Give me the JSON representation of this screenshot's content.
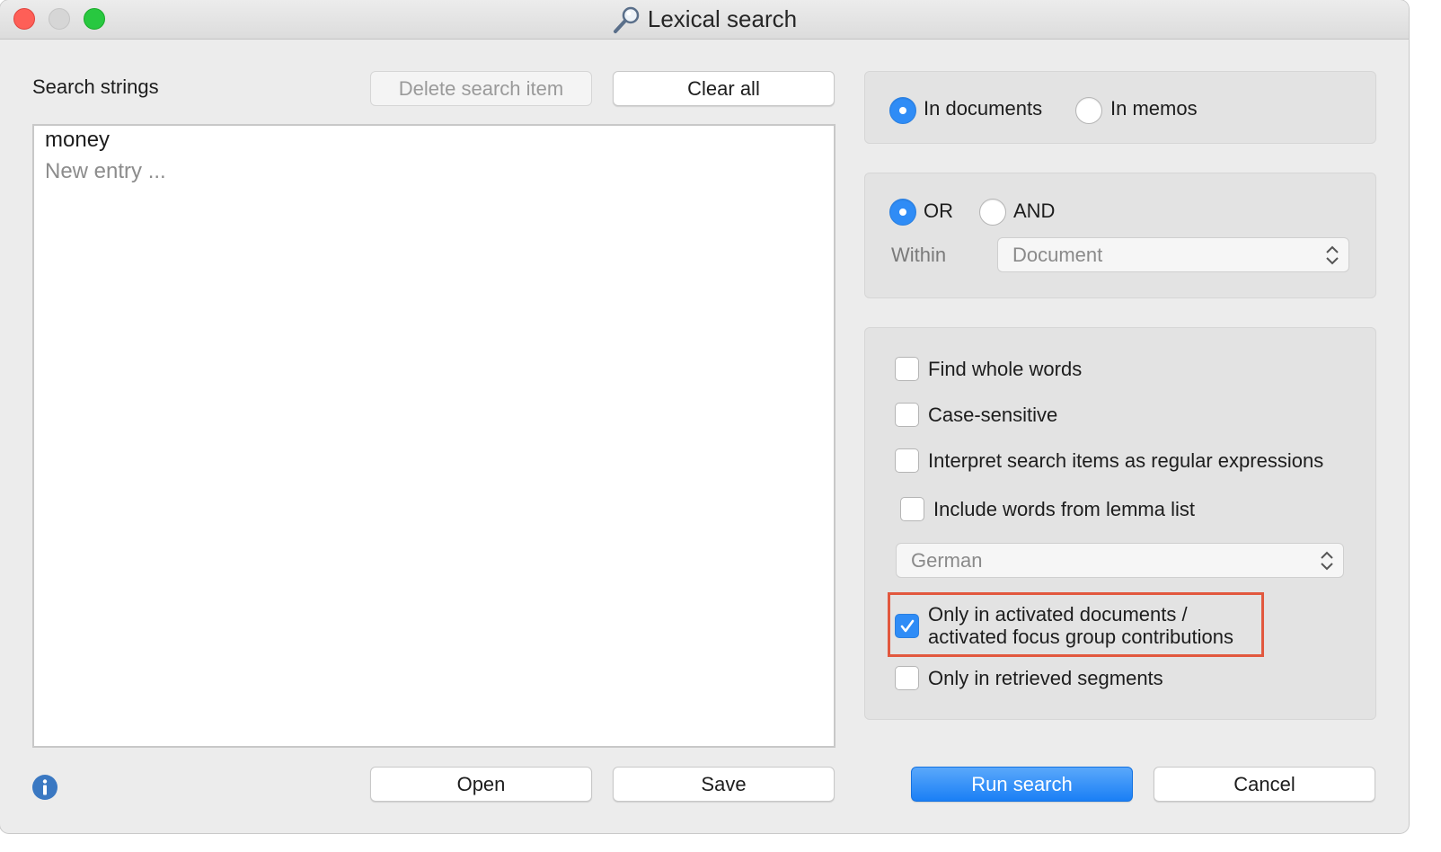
{
  "window": {
    "title": "Lexical search"
  },
  "icons": {
    "title": "magnifier-icon",
    "info": "info-icon",
    "check": "checkmark-icon",
    "select": "updown-chevron-icon"
  },
  "colors": {
    "accent": "#2f8cf6",
    "highlight": "#e2583e",
    "primary_button": "#1a7ff5"
  },
  "search": {
    "label": "Search strings",
    "delete_label": "Delete search item",
    "clear_label": "Clear all",
    "entries": [
      "money"
    ],
    "new_entry_placeholder": "New entry ..."
  },
  "scope": {
    "options": [
      {
        "label": "In documents",
        "selected": true
      },
      {
        "label": "In memos",
        "selected": false
      }
    ]
  },
  "logic": {
    "options": [
      {
        "label": "OR",
        "selected": true
      },
      {
        "label": "AND",
        "selected": false
      }
    ],
    "within_label": "Within",
    "within_value": "Document"
  },
  "options": {
    "whole_words": {
      "label": "Find whole words",
      "checked": false
    },
    "case_sensitive": {
      "label": "Case-sensitive",
      "checked": false
    },
    "regex": {
      "label": "Interpret search items as regular expressions",
      "checked": false
    },
    "lemma": {
      "label": "Include words from lemma list",
      "checked": false
    },
    "language": "German",
    "activated": {
      "label_line1": "Only in activated documents /",
      "label_line2": "activated focus group contributions",
      "checked": true
    },
    "retrieved": {
      "label": "Only in retrieved segments",
      "checked": false
    }
  },
  "footer": {
    "open_label": "Open",
    "save_label": "Save",
    "run_label": "Run search",
    "cancel_label": "Cancel"
  }
}
